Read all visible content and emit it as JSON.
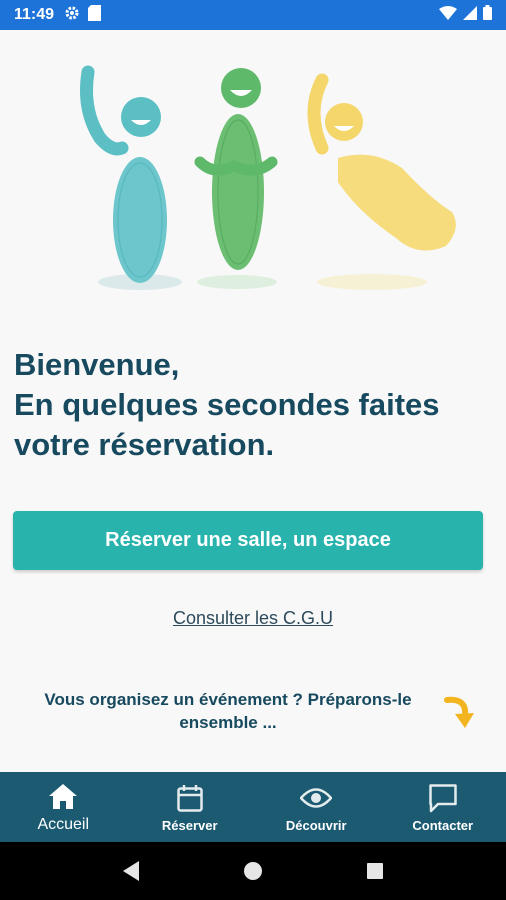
{
  "status_bar": {
    "time": "11:49",
    "left_icons": [
      "gear-icon",
      "sd-card-icon"
    ],
    "right_icons": [
      "wifi-icon",
      "signal-icon",
      "battery-icon"
    ],
    "color": "#1e73d9"
  },
  "welcome": {
    "line1": "Bienvenue,",
    "line2": "En quelques secondes faites",
    "line3": "votre réservation."
  },
  "primary_button": {
    "label": "Réserver une salle, un espace",
    "color": "#28b3ad"
  },
  "cgu_link": "Consulter les C.G.U",
  "event": {
    "line1": "Vous organisez un événement ? Préparons-le",
    "line2": "ensemble ..."
  },
  "bottom_nav": {
    "color": "#1b5a71",
    "items": [
      {
        "label": "Accueil",
        "icon": "home-icon",
        "active": true
      },
      {
        "label": "Réserver",
        "icon": "calendar-icon",
        "active": false
      },
      {
        "label": "Découvrir",
        "icon": "eye-icon",
        "active": false
      },
      {
        "label": "Contacter",
        "icon": "chat-icon",
        "active": false
      }
    ]
  },
  "system_nav": [
    "back-icon",
    "home-circle-icon",
    "recents-icon"
  ]
}
